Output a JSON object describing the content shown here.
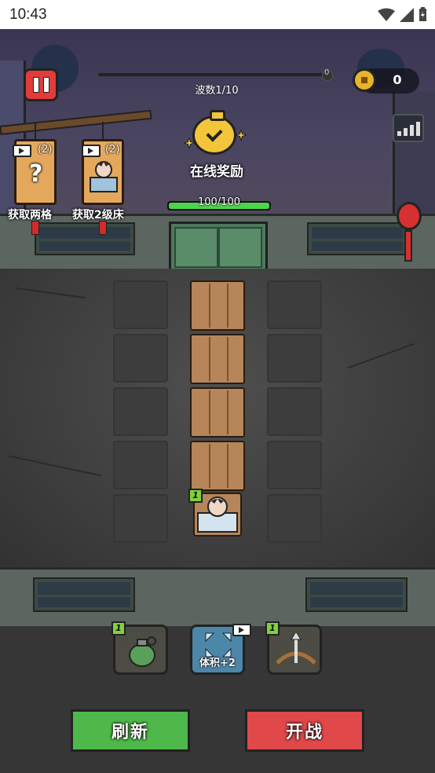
{
  "status_bar": {
    "time": "10:43"
  },
  "hud": {
    "wave_label": "波数1/10",
    "wave_count": "0",
    "wave_progress": 0,
    "coins": "0"
  },
  "reward": {
    "label": "在线奖励"
  },
  "unlock_cards": [
    {
      "label": "获取两格",
      "count": "(2)",
      "icon": "question-mark"
    },
    {
      "label": "获取2级床",
      "count": "(2)",
      "icon": "sleeping-character"
    }
  ],
  "door": {
    "hp_text": "100/100",
    "hp_fraction": 1.0
  },
  "grid": {
    "planks": 4,
    "bed_level": "1"
  },
  "items": [
    {
      "name": "grenade",
      "level": "1",
      "label": ""
    },
    {
      "name": "volume-upgrade",
      "level": "",
      "label": "体积+2",
      "ad": true
    },
    {
      "name": "crossbow",
      "level": "1",
      "label": ""
    }
  ],
  "buttons": {
    "refresh": "刷新",
    "fight": "开战"
  },
  "colors": {
    "refresh": "#4fb84a",
    "fight": "#e0484a",
    "hp": "#4cd44c",
    "coin": "#e8b42c"
  }
}
